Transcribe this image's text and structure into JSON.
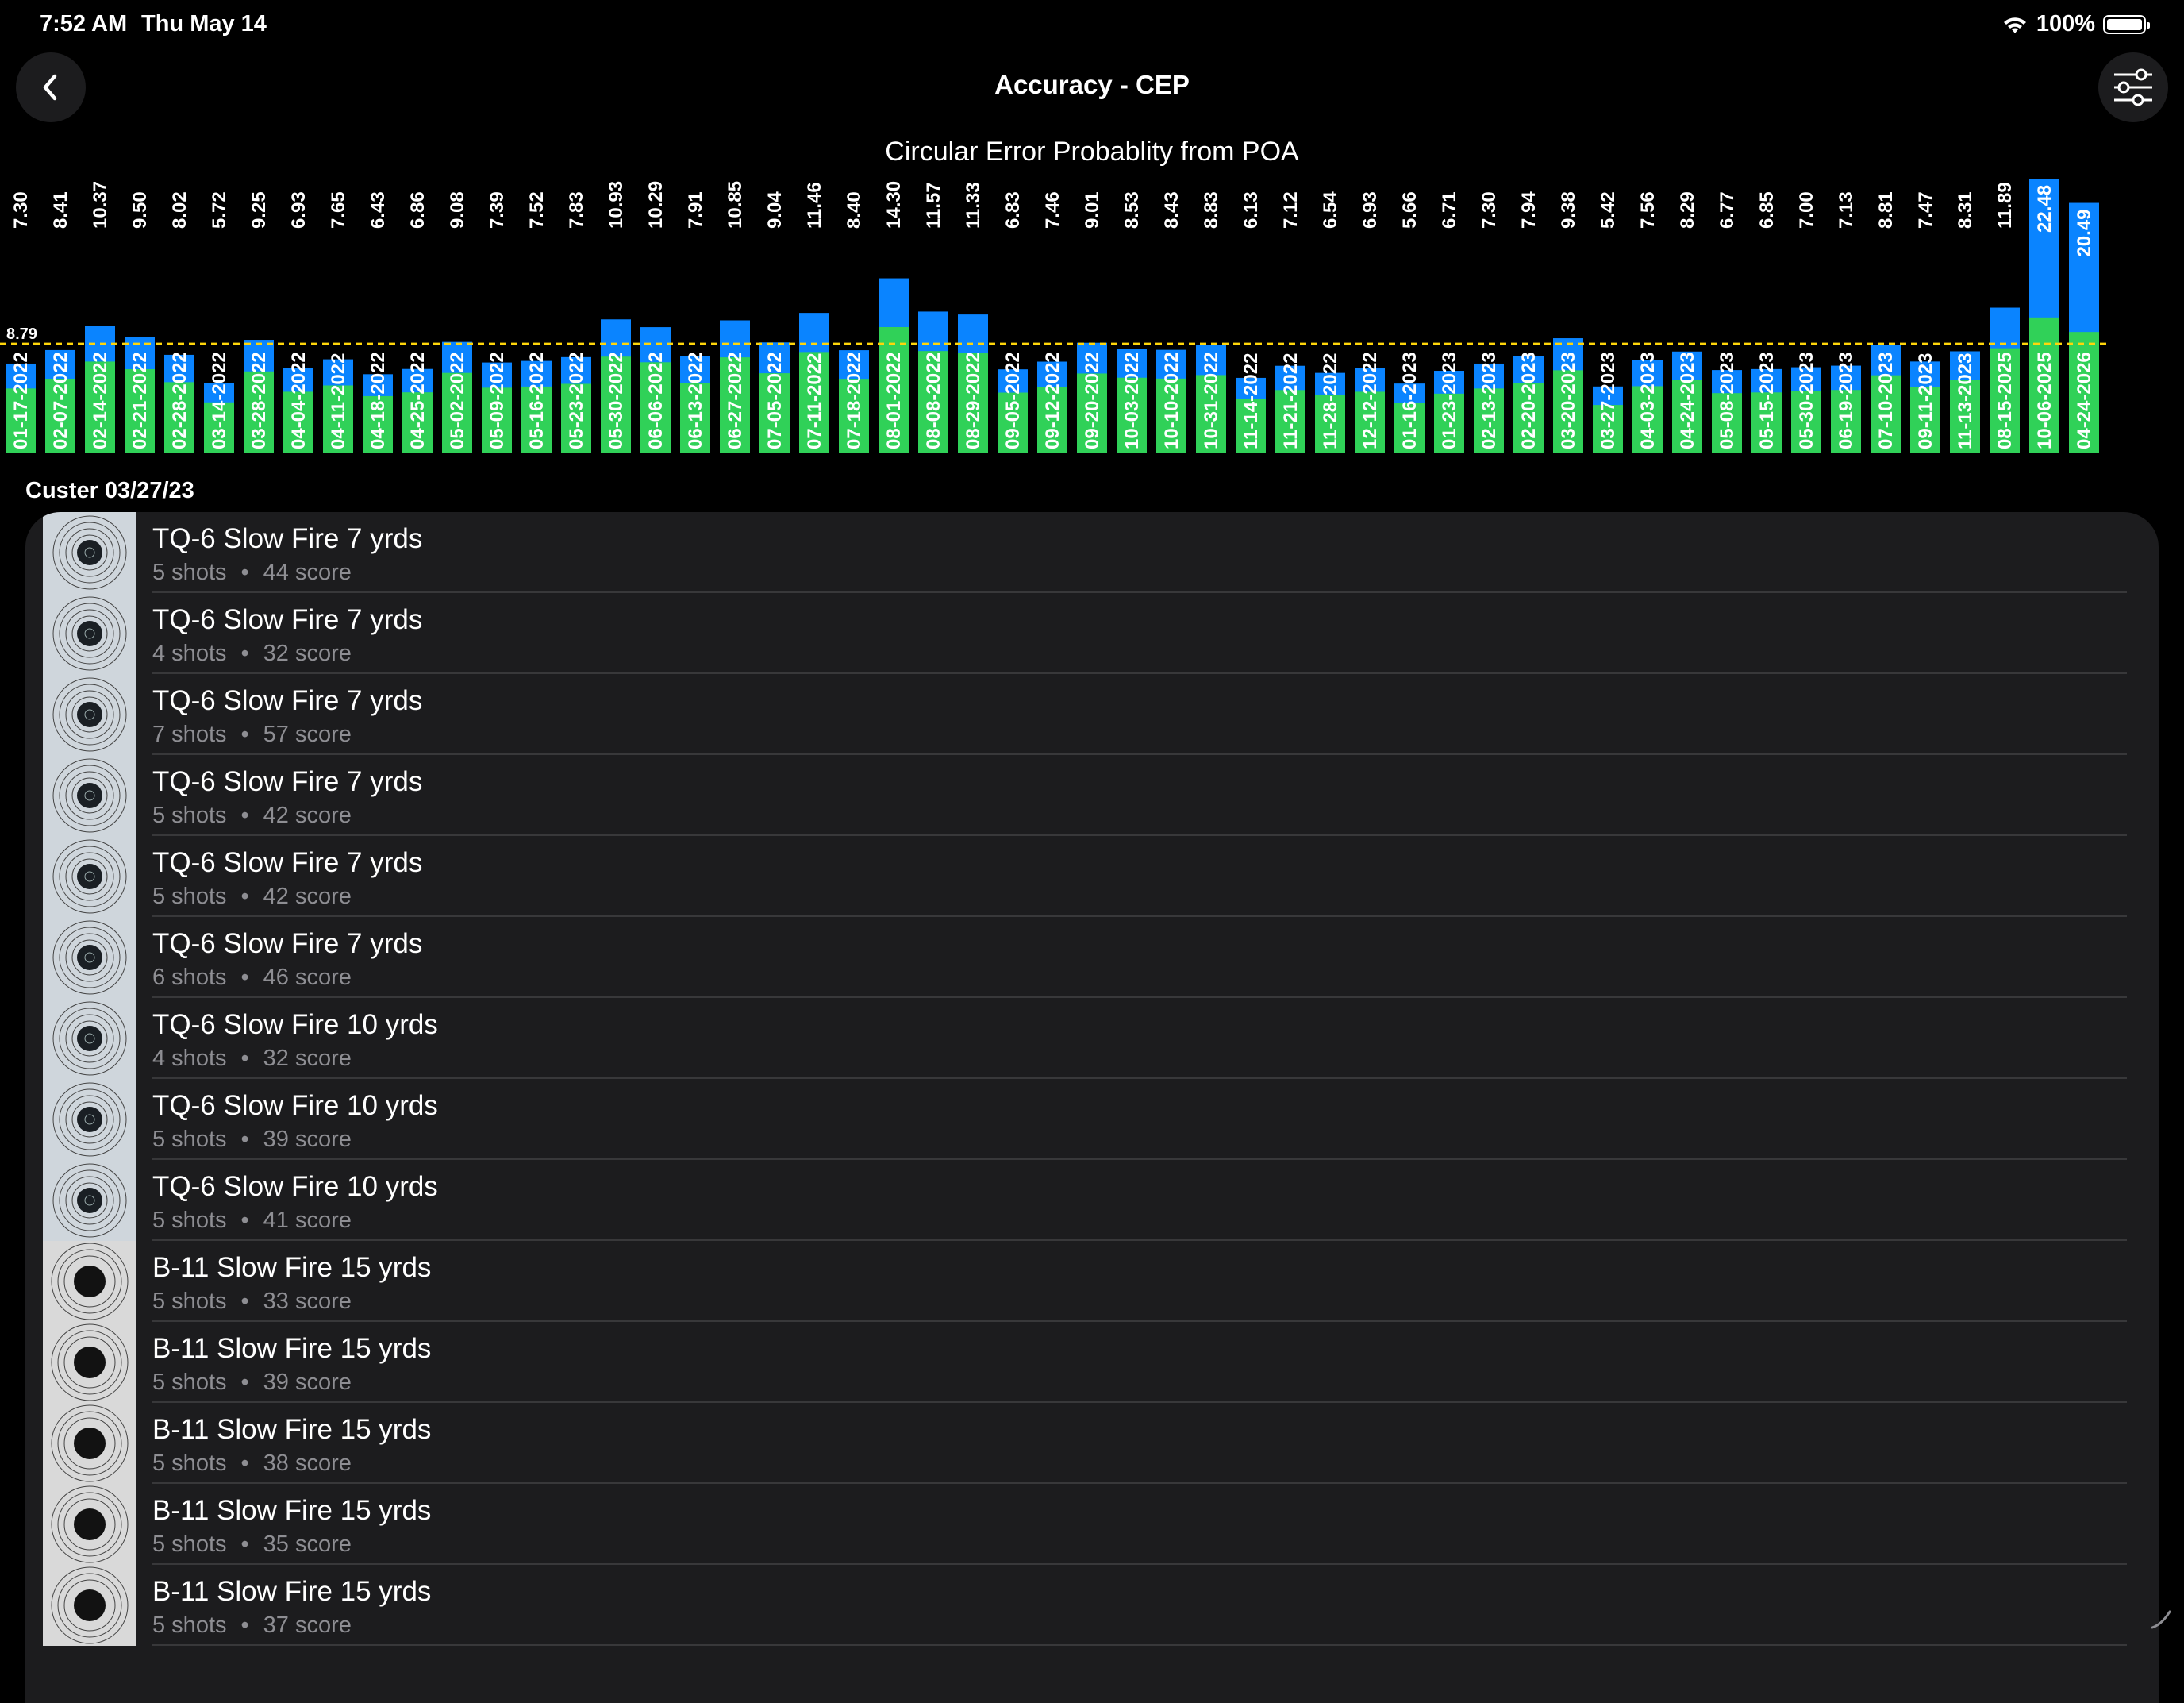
{
  "status": {
    "time": "7:52 AM",
    "date": "Thu May 14",
    "battery": "100%"
  },
  "nav": {
    "title": "Accuracy - CEP",
    "back_icon": "chevron-left-icon",
    "filter_icon": "sliders-icon"
  },
  "colors": {
    "blue": "#0a84ff",
    "green": "#30d158",
    "avg_line": "#ffd60a",
    "background": "#000000",
    "list_bg": "#1c1c1e"
  },
  "chart_data": {
    "type": "bar",
    "title": "Circular Error Probablity from POA",
    "average_label": "8.79",
    "average": 8.79,
    "ylim": [
      0,
      22.48
    ],
    "categories": [
      "01-17-2022",
      "02-07-2022",
      "02-14-2022",
      "02-21-2022",
      "02-28-2022",
      "03-14-2022",
      "03-28-2022",
      "04-04-2022",
      "04-11-2022",
      "04-18-2022",
      "04-25-2022",
      "05-02-2022",
      "05-09-2022",
      "05-16-2022",
      "05-23-2022",
      "05-30-2022",
      "06-06-2022",
      "06-13-2022",
      "06-27-2022",
      "07-05-2022",
      "07-11-2022",
      "07-18-2022",
      "08-01-2022",
      "08-08-2022",
      "08-29-2022",
      "09-05-2022",
      "09-12-2022",
      "09-20-2022",
      "10-03-2022",
      "10-10-2022",
      "10-31-2022",
      "11-14-2022",
      "11-21-2022",
      "11-28-2022",
      "12-12-2022",
      "01-16-2023",
      "01-23-2023",
      "02-13-2023",
      "02-20-2023",
      "03-20-2023",
      "03-27-2023",
      "04-03-2023",
      "04-24-2023",
      "05-08-2023",
      "05-15-2023",
      "05-30-2023",
      "06-19-2023",
      "07-10-2023",
      "09-11-2023",
      "11-13-2023",
      "08-15-2025",
      "10-06-2025",
      "04-24-2026"
    ],
    "values": [
      7.3,
      8.41,
      10.37,
      9.5,
      8.02,
      5.72,
      9.25,
      6.93,
      7.65,
      6.43,
      6.86,
      9.08,
      7.39,
      7.52,
      7.83,
      10.93,
      10.29,
      7.91,
      10.85,
      9.04,
      11.46,
      8.4,
      14.3,
      11.57,
      11.33,
      6.83,
      7.46,
      9.01,
      8.53,
      8.43,
      8.83,
      6.13,
      7.12,
      6.54,
      6.93,
      5.66,
      6.71,
      7.3,
      7.94,
      9.38,
      5.42,
      7.56,
      8.29,
      6.77,
      6.85,
      7.0,
      7.13,
      8.81,
      7.47,
      8.31,
      11.89,
      22.48,
      20.49
    ],
    "value_labels": [
      "7.30",
      "8.41",
      "10.37",
      "9.50",
      "8.02",
      "5.72",
      "9.25",
      "6.93",
      "7.65",
      "6.43",
      "6.86",
      "9.08",
      "7.39",
      "7.52",
      "7.83",
      "10.93",
      "10.29",
      "7.91",
      "10.85",
      "9.04",
      "11.46",
      "8.40",
      "14.30",
      "11.57",
      "11.33",
      "6.83",
      "7.46",
      "9.01",
      "8.53",
      "8.43",
      "8.83",
      "6.13",
      "7.12",
      "6.54",
      "6.93",
      "5.66",
      "6.71",
      "7.30",
      "7.94",
      "9.38",
      "5.42",
      "7.56",
      "8.29",
      "6.77",
      "6.85",
      "7.00",
      "7.13",
      "8.81",
      "7.47",
      "8.31",
      "11.89",
      "22.48",
      "20.49"
    ]
  },
  "list": {
    "section_title": "Custer 03/27/23",
    "dot": "•",
    "rows": [
      {
        "title": "TQ-6 Slow Fire 7 yrds",
        "shots": "5 shots",
        "score": "44 score",
        "target": "tq6"
      },
      {
        "title": "TQ-6 Slow Fire 7 yrds",
        "shots": "4 shots",
        "score": "32 score",
        "target": "tq6"
      },
      {
        "title": "TQ-6 Slow Fire 7 yrds",
        "shots": "7 shots",
        "score": "57 score",
        "target": "tq6"
      },
      {
        "title": "TQ-6 Slow Fire 7 yrds",
        "shots": "5 shots",
        "score": "42 score",
        "target": "tq6"
      },
      {
        "title": "TQ-6 Slow Fire 7 yrds",
        "shots": "5 shots",
        "score": "42 score",
        "target": "tq6"
      },
      {
        "title": "TQ-6 Slow Fire 7 yrds",
        "shots": "6 shots",
        "score": "46 score",
        "target": "tq6"
      },
      {
        "title": "TQ-6 Slow Fire 10 yrds",
        "shots": "4 shots",
        "score": "32 score",
        "target": "tq6"
      },
      {
        "title": "TQ-6 Slow Fire 10 yrds",
        "shots": "5 shots",
        "score": "39 score",
        "target": "tq6"
      },
      {
        "title": "TQ-6 Slow Fire 10 yrds",
        "shots": "5 shots",
        "score": "41 score",
        "target": "tq6"
      },
      {
        "title": "B-11 Slow Fire 15 yrds",
        "shots": "5 shots",
        "score": "33 score",
        "target": "b11"
      },
      {
        "title": "B-11 Slow Fire 15 yrds",
        "shots": "5 shots",
        "score": "39 score",
        "target": "b11"
      },
      {
        "title": "B-11 Slow Fire 15 yrds",
        "shots": "5 shots",
        "score": "38 score",
        "target": "b11"
      },
      {
        "title": "B-11 Slow Fire 15 yrds",
        "shots": "5 shots",
        "score": "35 score",
        "target": "b11"
      },
      {
        "title": "B-11 Slow Fire 15 yrds",
        "shots": "5 shots",
        "score": "37 score",
        "target": "b11"
      }
    ]
  }
}
